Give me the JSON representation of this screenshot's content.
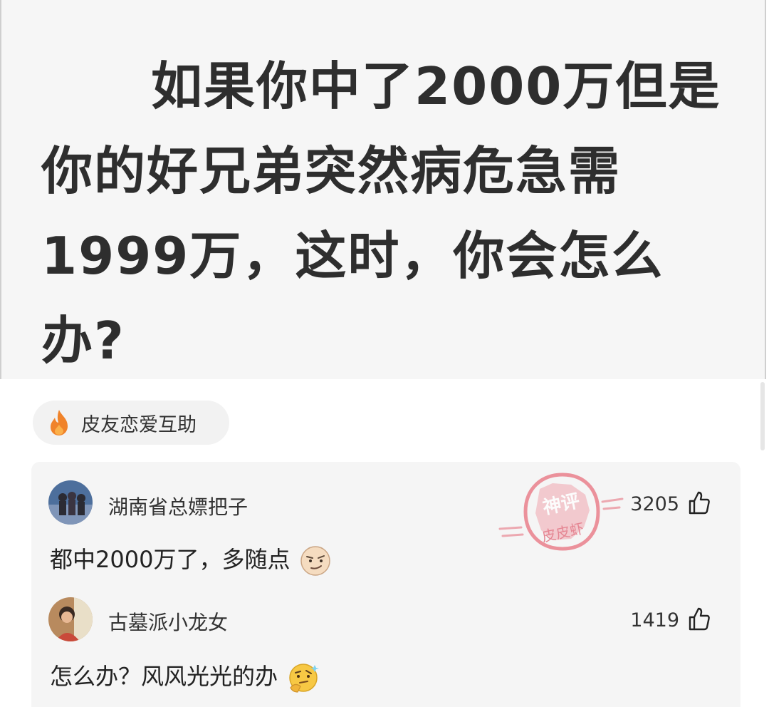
{
  "post": {
    "question": "如果你中了2000万但是你的好兄弟突然病危急需1999万，这时，你会怎么办?"
  },
  "tag": {
    "label": "皮友恋爱互助",
    "icon": "fire-icon",
    "color": "#f0832a"
  },
  "watermark": {
    "line1": "神评",
    "line2": "皮皮虾",
    "color": "#e8707e"
  },
  "comments": [
    {
      "username": "湖南省总嫖把子",
      "likes": "3205",
      "text": "都中2000万了，多随点",
      "emoji": "smirk-face-emoji"
    },
    {
      "username": "古墓派小龙女",
      "likes": "1419",
      "text": "怎么办？风风光光的办",
      "emoji": "thinking-face-emoji"
    }
  ],
  "colors": {
    "card_background": "#f6f6f6",
    "panel_background": "#f5f5f5",
    "text": "#222222"
  }
}
